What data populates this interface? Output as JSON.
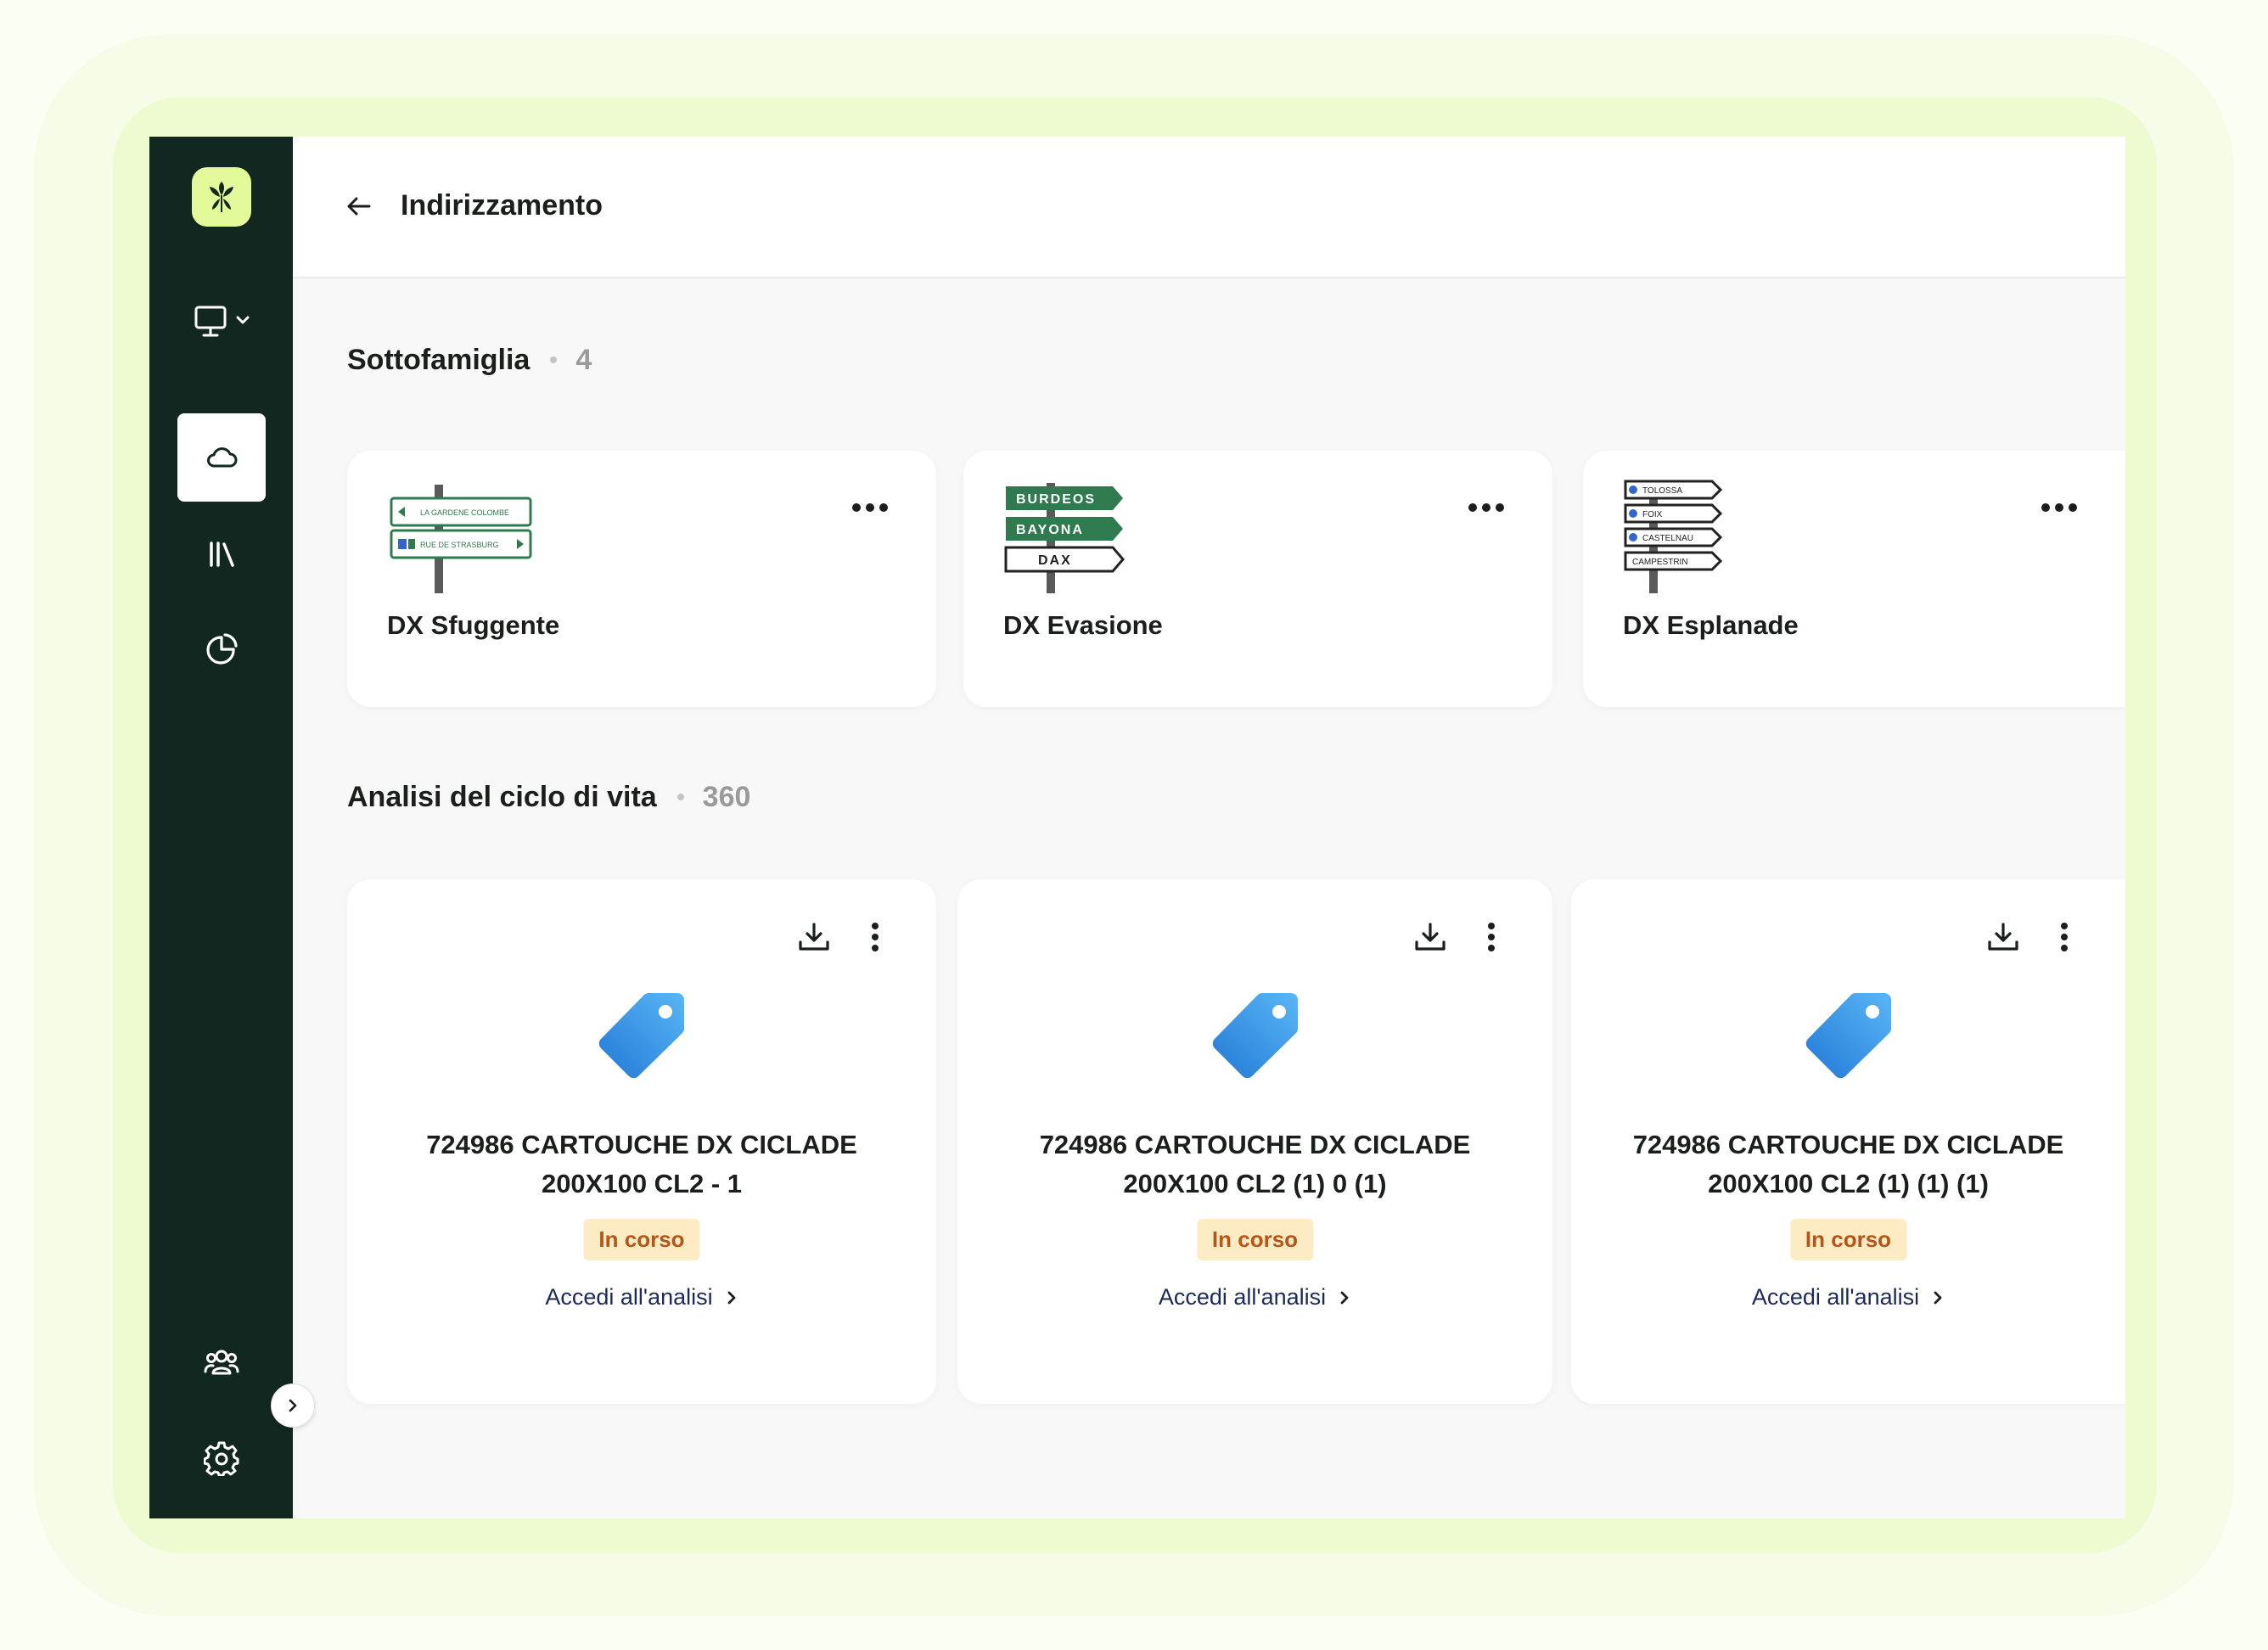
{
  "header": {
    "title": "Indirizzamento"
  },
  "sidebar": {
    "items": [
      {
        "name": "monitor-dropdown",
        "icon": "monitor-icon"
      },
      {
        "name": "cloud",
        "icon": "cloud-icon",
        "active": true
      },
      {
        "name": "library",
        "icon": "library-icon"
      },
      {
        "name": "pie-chart",
        "icon": "pie-chart-icon"
      },
      {
        "name": "users",
        "icon": "users-icon"
      },
      {
        "name": "settings",
        "icon": "gear-icon"
      }
    ]
  },
  "subfamily": {
    "label": "Sottofamiglia",
    "count": "4",
    "cards": [
      {
        "name": "DX Sfuggente",
        "sign_lines": [
          "LA GARDENE COLOMBE",
          "RUE DE STRASBURG"
        ]
      },
      {
        "name": "DX Evasione",
        "sign_lines": [
          "BURDEOS",
          "BAYONA",
          "DAX"
        ]
      },
      {
        "name": "DX Esplanade",
        "sign_lines": [
          "TOLOSSA",
          "FOIX",
          "CASTELNAU",
          "CAMPESTRIN"
        ]
      }
    ]
  },
  "lca": {
    "label": "Analisi del ciclo di vita",
    "count": "360",
    "cards": [
      {
        "title_line1": "724986 CARTOUCHE DX CICLADE",
        "title_line2": "200X100 CL2 - 1",
        "status": "In corso",
        "link": "Accedi all'analisi"
      },
      {
        "title_line1": "724986 CARTOUCHE DX CICLADE",
        "title_line2": "200X100 CL2 (1) 0 (1)",
        "status": "In corso",
        "link": "Accedi all'analisi"
      },
      {
        "title_line1": "724986 CARTOUCHE DX CICLADE",
        "title_line2": "200X100 CL2 (1) (1) (1)",
        "status": "In corso",
        "link": "Accedi all'analisi"
      }
    ]
  },
  "colors": {
    "sidebar": "#12271f",
    "logo_bg": "#e3fa9a",
    "badge_bg": "#fdecc3",
    "badge_text": "#b4551a",
    "tag_blue": "#3a9be6",
    "sign_green": "#2f7a4f"
  }
}
